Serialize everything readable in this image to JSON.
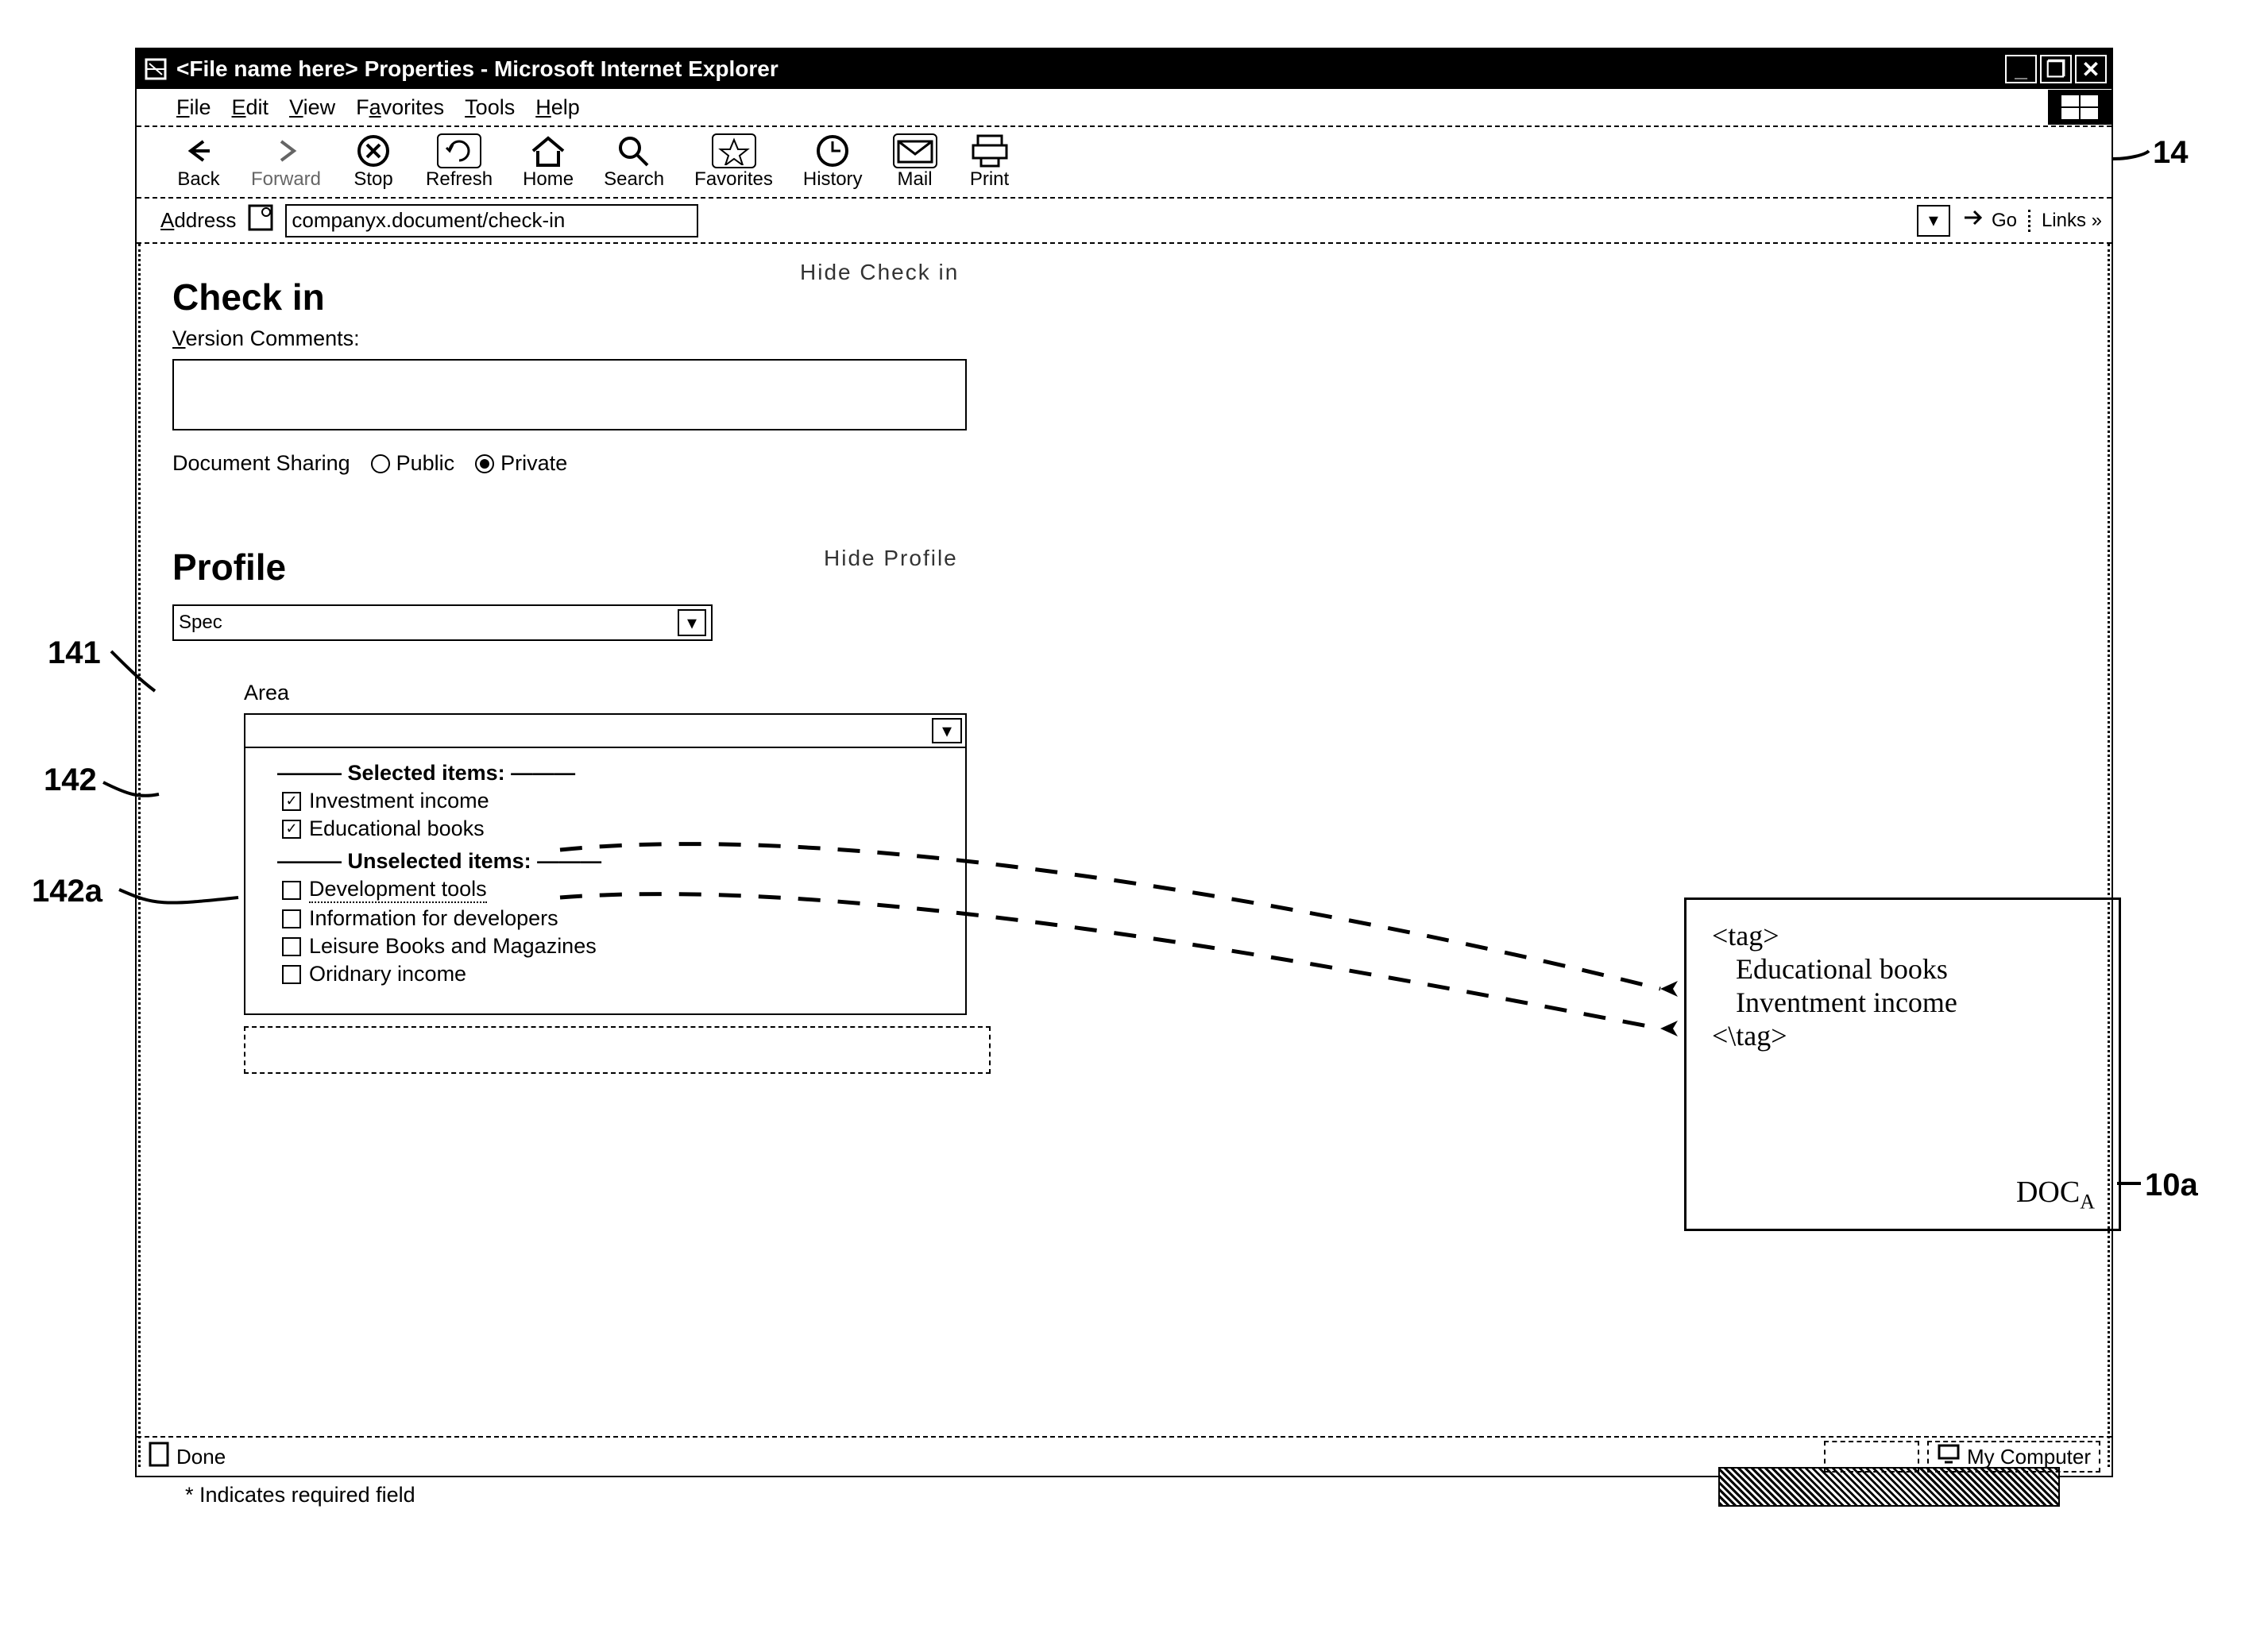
{
  "window": {
    "title": "<File name here> Properties - Microsoft Internet Explorer",
    "caption": {
      "min": "_",
      "max": "❐",
      "close": "✕"
    }
  },
  "menu": {
    "file": "File",
    "edit": "Edit",
    "view": "View",
    "favorites": "Favorites",
    "tools": "Tools",
    "help": "Help"
  },
  "toolbar": {
    "back": "Back",
    "forward": "Forward",
    "stop": "Stop",
    "refresh": "Refresh",
    "home": "Home",
    "search": "Search",
    "favorites": "Favorites",
    "history": "History",
    "mail": "Mail",
    "print": "Print"
  },
  "address": {
    "label": "Address",
    "value": "companyx.document/check-in",
    "go": "Go",
    "links": "Links »"
  },
  "page": {
    "hide_checkin": "Hide Check in",
    "checkin_h": "Check in",
    "vcomments_lbl": "Version Comments:",
    "sharing_lbl": "Document Sharing",
    "sharing_public": "Public",
    "sharing_private": "Private",
    "hide_profile": "Hide Profile",
    "profile_h": "Profile",
    "spec_value": "Spec",
    "area_lbl": "Area",
    "selected_h": "Selected items:",
    "unselected_h": "Unselected items:",
    "items_selected": [
      "Investment income",
      "Educational books"
    ],
    "items_unselected": [
      "Development tools",
      "Information for developers",
      "Leisure Books and Magazines",
      "Oridnary income"
    ],
    "required_note": "* Indicates required field"
  },
  "status": {
    "done": "Done",
    "zone": "My Computer"
  },
  "docbox": {
    "tag_open": "<tag>",
    "line1": "Educational books",
    "line2": "Inventment income",
    "tag_close": "<\\tag>",
    "doc_prefix": "DOC",
    "doc_sub": "A"
  },
  "annotations": {
    "a14": "14",
    "a141": "141",
    "a142": "142",
    "a142a": "142a",
    "a10a": "10a"
  }
}
